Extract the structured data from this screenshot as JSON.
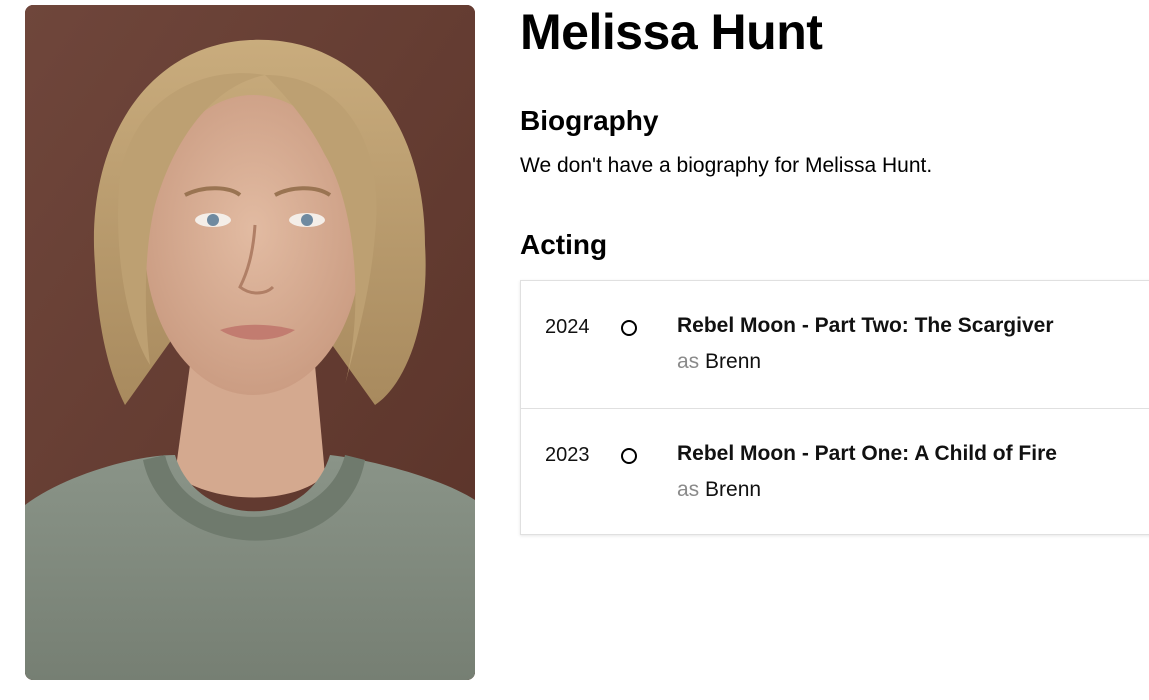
{
  "person": {
    "name": "Melissa Hunt"
  },
  "biography": {
    "heading": "Biography",
    "text": "We don't have a biography for Melissa Hunt."
  },
  "acting": {
    "heading": "Acting",
    "credits": [
      {
        "year": "2024",
        "title": "Rebel Moon - Part Two: The Scargiver",
        "as_word": "as",
        "character": "Brenn"
      },
      {
        "year": "2023",
        "title": "Rebel Moon - Part One: A Child of Fire",
        "as_word": "as",
        "character": "Brenn"
      }
    ]
  },
  "colors": {
    "portrait_background": "#6d4338",
    "timeline_dot": "#000000",
    "muted_text": "#8a8a8a",
    "border": "#e0e0e0"
  }
}
